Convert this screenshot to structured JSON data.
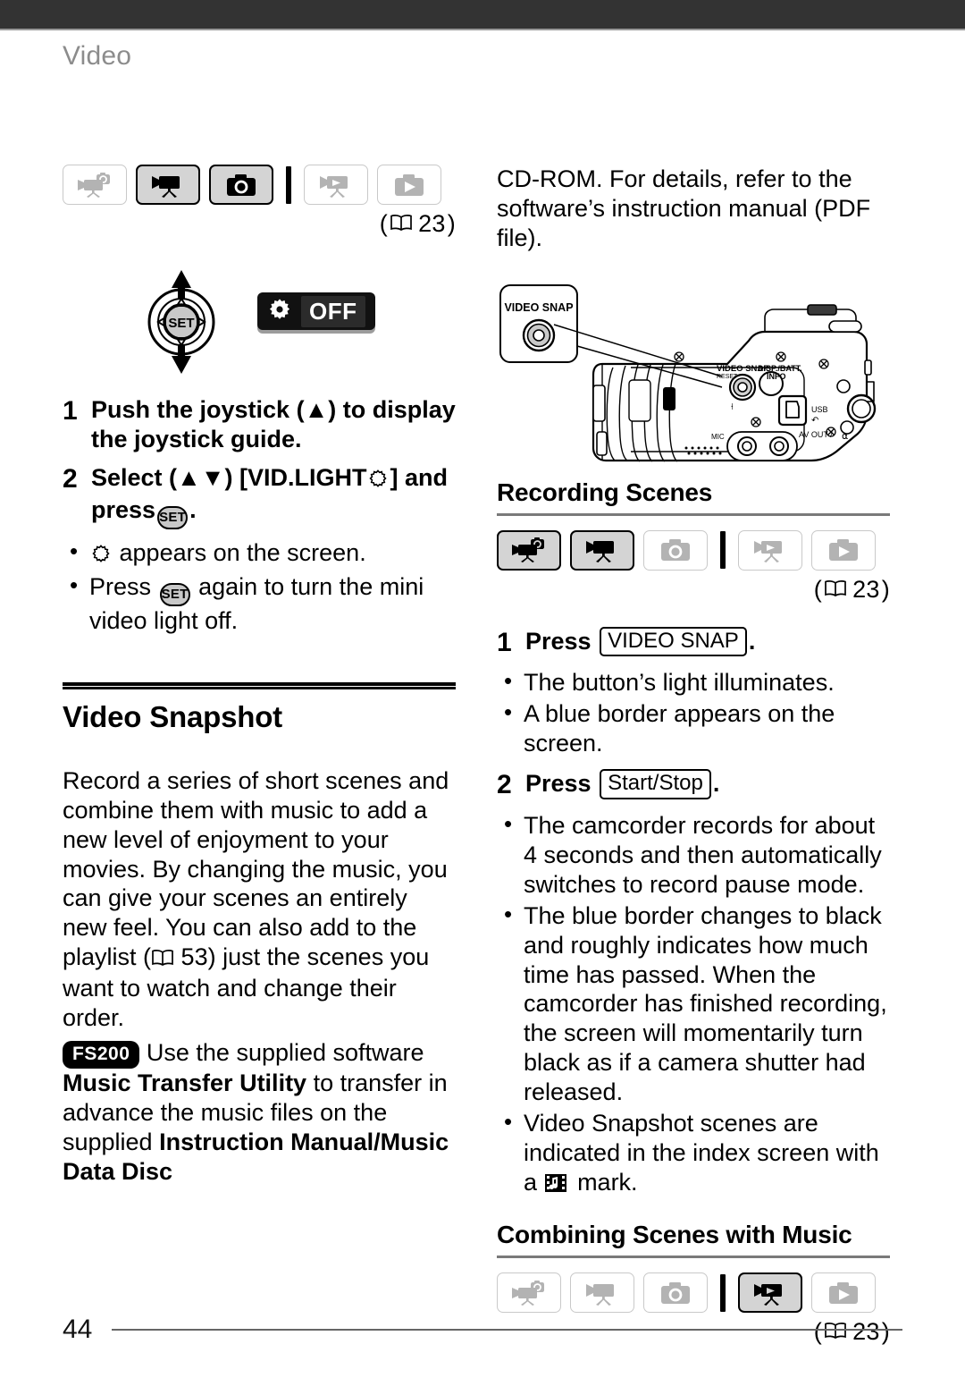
{
  "page": {
    "running_head": "Video",
    "folio": "44"
  },
  "mode_rows": {
    "top": {
      "icons": [
        {
          "name": "dual-shot-mode",
          "state": "off"
        },
        {
          "name": "movie-record-mode",
          "state": "on"
        },
        {
          "name": "photo-record-mode",
          "state": "on"
        },
        {
          "name": "movie-play-mode",
          "state": "off"
        },
        {
          "name": "photo-play-mode",
          "state": "off"
        }
      ],
      "ref": "23",
      "ref_open": "(",
      "ref_close": ")"
    },
    "recording_scenes": {
      "icons": [
        {
          "name": "dual-shot-mode",
          "state": "on"
        },
        {
          "name": "movie-record-mode",
          "state": "on"
        },
        {
          "name": "photo-record-mode",
          "state": "off"
        },
        {
          "name": "movie-play-mode",
          "state": "off"
        },
        {
          "name": "photo-play-mode",
          "state": "off"
        }
      ],
      "ref": "23",
      "ref_open": "(",
      "ref_close": ")"
    },
    "combining_scenes": {
      "icons": [
        {
          "name": "dual-shot-mode",
          "state": "off"
        },
        {
          "name": "movie-record-mode",
          "state": "off"
        },
        {
          "name": "photo-record-mode",
          "state": "off"
        },
        {
          "name": "movie-play-mode",
          "state": "on"
        },
        {
          "name": "photo-play-mode",
          "state": "off"
        }
      ],
      "ref": "23",
      "ref_open": "(",
      "ref_close": ")"
    }
  },
  "vid_light": {
    "joystick_icon": "joystick-guide-icon",
    "set_label": "SET",
    "off_badge": {
      "icon": "video-light-gear-icon",
      "label": "OFF"
    },
    "steps": [
      {
        "num": "1",
        "text_a": "Push the joystick (",
        "text_b": ") to display the joystick guide."
      },
      {
        "num": "2",
        "text_a": "Select (",
        "text_b": ") [VID.LIGHT",
        "text_c": "] and press",
        "text_d": "."
      }
    ],
    "bullets": [
      {
        "pre": "",
        "post": "appears on the screen."
      },
      {
        "pre": "Press",
        "post": "again to turn the mini video light off."
      }
    ]
  },
  "video_snapshot": {
    "heading": "Video Snapshot",
    "paragraph_1": "Record a series of short scenes and combine them with music to add a new level of enjoyment to your movies. By changing the music, you can give your scenes an entirely new feel. You can also add to the playlist (",
    "paragraph_1_ref": "53",
    "paragraph_1_tail": ") just the scenes you want to watch and change their order.",
    "model_badge": "FS200",
    "paragraph_2_a": "Use the supplied software",
    "paragraph_2_bold_1": "Music Transfer Utility",
    "paragraph_2_b": "to transfer in advance the music files on the supplied",
    "paragraph_2_bold_2": "Instruction Manual/Music Data Disc"
  },
  "right_column": {
    "intro_text": "CD-ROM. For details, refer to the software’s instruction manual (PDF file).",
    "camcorder_figure": {
      "callout_label": "VIDEO SNAP",
      "labels": {
        "video_snap": "VIDEO SNAP",
        "reset": "RESET",
        "disp_batt": "DISP./BATT.",
        "info": "INFO",
        "usb": "USB",
        "mic": "MIC",
        "av_out": "AV OUT /"
      }
    },
    "recording_scenes": {
      "heading": "Recording Scenes",
      "steps": [
        {
          "num": "1",
          "label": "Press",
          "key": "VIDEO SNAP",
          "tail": ".",
          "bullets": [
            "The button’s light illuminates.",
            "A blue border appears on the screen."
          ]
        },
        {
          "num": "2",
          "label": "Press",
          "key": "Start/Stop",
          "tail": ".",
          "bullets": [
            "The camcorder records for about 4 seconds and then automatically switches to record pause mode.",
            "The blue border changes to black and roughly indicates how much time has passed. When the camcorder has finished recording, the screen will momentarily turn black as if a camera shutter had released."
          ],
          "bullet_last_pre": "Video Snapshot scenes are indicated in the index screen with a",
          "bullet_last_post": "mark."
        }
      ]
    },
    "combining_scenes": {
      "heading": "Combining Scenes with Music"
    }
  }
}
